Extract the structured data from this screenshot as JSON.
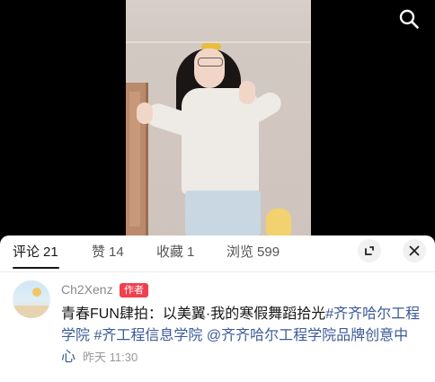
{
  "video": {
    "search_icon": "search-icon"
  },
  "tabs": [
    {
      "label": "评论",
      "count": "21"
    },
    {
      "label": "赞",
      "count": "14"
    },
    {
      "label": "收藏",
      "count": "1"
    },
    {
      "label": "浏览",
      "count": "599"
    }
  ],
  "sheet_icons": {
    "expand": "collapse-arrow-icon",
    "close": "close-icon"
  },
  "comment": {
    "username": "Ch2Xenz",
    "badge": "作者",
    "text": "青春FUN肆拍：以美翼·我的寒假舞蹈拾光",
    "hashtags": [
      "#齐齐哈尔工程学院",
      "#齐工程信息学院"
    ],
    "mention": "@齐齐哈尔工程学院品牌创意中心",
    "time": "昨天 11:30"
  },
  "colors": {
    "link": "#3a5a97",
    "badge_bg": "#f03f4d",
    "text": "#161616",
    "muted": "#8a8a8a"
  }
}
